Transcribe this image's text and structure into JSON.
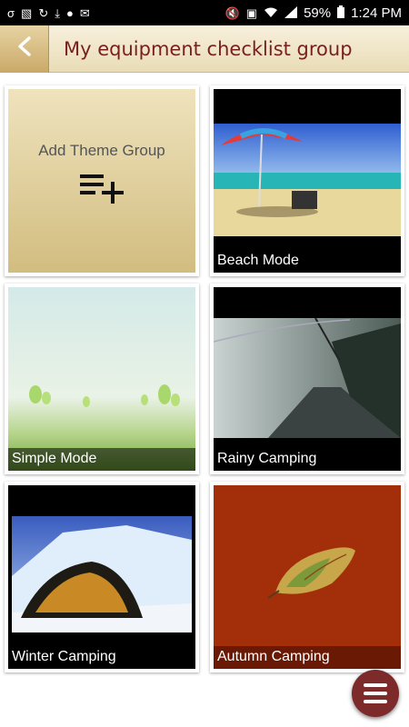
{
  "status_bar": {
    "battery": "59%",
    "time": "1:24 PM",
    "left_icons": [
      "notification-icon",
      "photo-icon",
      "sync-icon",
      "download-icon",
      "app-icon",
      "mail-icon"
    ],
    "right_icons": [
      "mute-icon",
      "nfc-icon",
      "wifi-icon",
      "signal-icon",
      "battery-icon"
    ]
  },
  "app_bar": {
    "title": "My equipment checklist group",
    "back_icon": "back-arrow-icon"
  },
  "add_card": {
    "label": "Add Theme Group",
    "icon": "playlist-add-icon"
  },
  "theme_cards": [
    {
      "label": "Beach Mode"
    },
    {
      "label": "Simple Mode"
    },
    {
      "label": "Rainy Camping"
    },
    {
      "label": "Winter Camping"
    },
    {
      "label": "Autumn Camping"
    }
  ],
  "fab": {
    "icon": "menu-icon"
  },
  "colors": {
    "accent": "#7a1f1f",
    "fab": "#7c2a2a",
    "header": "#efe3bd"
  }
}
